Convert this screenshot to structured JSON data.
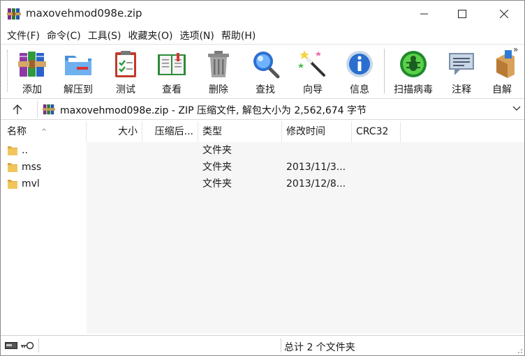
{
  "window": {
    "title": "maxovehmod098e.zip",
    "controls": {
      "minimize": "minimize",
      "maximize": "maximize",
      "close": "close"
    }
  },
  "menu": {
    "items": [
      "文件(F)",
      "命令(C)",
      "工具(S)",
      "收藏夹(O)",
      "选项(N)",
      "帮助(H)"
    ]
  },
  "toolbar": {
    "buttons": [
      {
        "label": "添加",
        "icon": "winrar-books-icon"
      },
      {
        "label": "解压到",
        "icon": "extract-folder-icon"
      },
      {
        "label": "测试",
        "icon": "test-clipboard-icon"
      },
      {
        "label": "查看",
        "icon": "view-book-icon"
      },
      {
        "label": "删除",
        "icon": "trash-can-icon"
      },
      {
        "label": "查找",
        "icon": "magnifier-icon"
      },
      {
        "label": "向导",
        "icon": "magic-wand-icon"
      },
      {
        "label": "信息",
        "icon": "info-icon"
      },
      {
        "label": "扫描病毒",
        "icon": "virus-scan-icon"
      },
      {
        "label": "注释",
        "icon": "comment-icon"
      },
      {
        "label": "自解",
        "icon": "sfx-box-icon"
      }
    ],
    "more": "»"
  },
  "address": {
    "text": "maxovehmod098e.zip - ZIP 压缩文件, 解包大小为 2,562,674 字节"
  },
  "filelist": {
    "columns": [
      "名称",
      "大小",
      "压缩后...",
      "类型",
      "修改时间",
      "CRC32"
    ],
    "rows": [
      {
        "name": "..",
        "type": "文件夹",
        "modified": ""
      },
      {
        "name": "mss",
        "type": "文件夹",
        "modified": "2013/11/3..."
      },
      {
        "name": "mvl",
        "type": "文件夹",
        "modified": "2013/12/8..."
      }
    ]
  },
  "status": {
    "text": "总计 2 个文件夹"
  },
  "colors": {
    "folder": "#f2c55c",
    "accent": "#0078d7"
  }
}
